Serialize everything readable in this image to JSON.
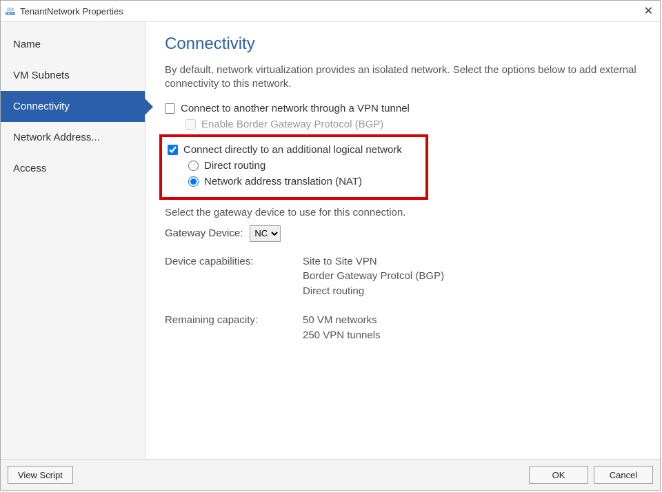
{
  "window": {
    "title": "TenantNetwork Properties"
  },
  "sidebar": {
    "items": [
      {
        "label": "Name",
        "selected": false
      },
      {
        "label": "VM Subnets",
        "selected": false
      },
      {
        "label": "Connectivity",
        "selected": true
      },
      {
        "label": "Network Address...",
        "selected": false
      },
      {
        "label": "Access",
        "selected": false
      }
    ]
  },
  "content": {
    "heading": "Connectivity",
    "description": "By default, network virtualization provides an isolated network. Select the options below to add external connectivity to this network.",
    "vpn": {
      "label": "Connect to another network through a VPN tunnel",
      "checked": false,
      "bgp": {
        "label": "Enable Border Gateway Protocol (BGP)",
        "checked": false
      }
    },
    "direct": {
      "label": "Connect directly to an additional logical network",
      "checked": true,
      "routing": {
        "direct_label": "Direct routing",
        "nat_label": "Network address translation (NAT)",
        "value": "nat"
      }
    },
    "gateway": {
      "help": "Select the gateway device to use for this connection.",
      "label": "Gateway Device:",
      "value": "NC"
    },
    "capabilities": {
      "label": "Device capabilities:",
      "lines": {
        "a": "Site to Site VPN",
        "b": "Border Gateway Protcol (BGP)",
        "c": "Direct routing"
      }
    },
    "remaining": {
      "label": "Remaining capacity:",
      "lines": {
        "a": "50 VM networks",
        "b": "250 VPN tunnels"
      }
    }
  },
  "footer": {
    "view_script": "View Script",
    "ok": "OK",
    "cancel": "Cancel"
  }
}
